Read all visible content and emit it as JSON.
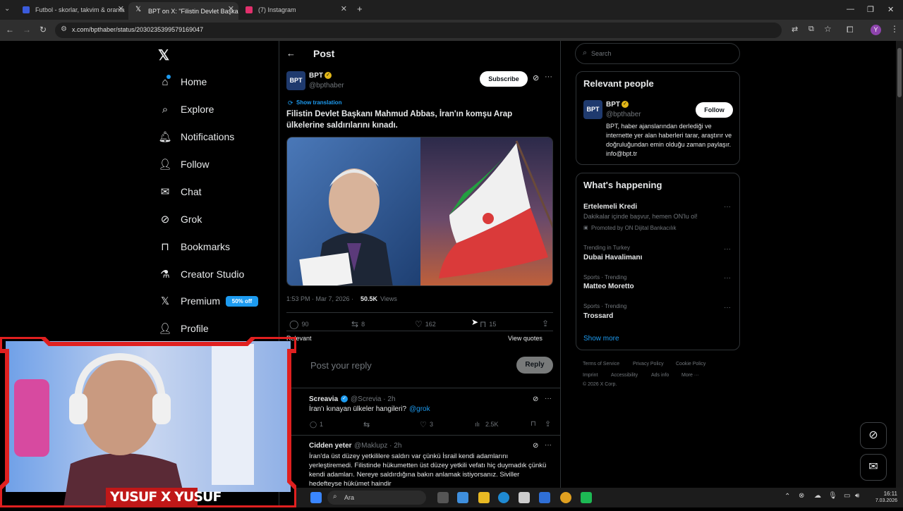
{
  "browser": {
    "tabs": [
      {
        "title": "Futbol - skorlar, takvim & oranla",
        "favicon_color": "#3b5bdb"
      },
      {
        "title": "BPT on X: \"Filistin Devlet Başka",
        "favicon_color": "#ffffff"
      },
      {
        "title": "(7) Instagram",
        "favicon_color": "#e1306c"
      }
    ],
    "url": "x.com/bpthaber/status/2030235399579169047"
  },
  "sidebar": {
    "items": [
      {
        "label": "Home",
        "icon": "home-icon"
      },
      {
        "label": "Explore",
        "icon": "search-icon"
      },
      {
        "label": "Notifications",
        "icon": "bell-icon"
      },
      {
        "label": "Follow",
        "icon": "person-add-icon"
      },
      {
        "label": "Chat",
        "icon": "mail-icon"
      },
      {
        "label": "Grok",
        "icon": "grok-icon"
      },
      {
        "label": "Bookmarks",
        "icon": "bookmark-icon"
      },
      {
        "label": "Creator Studio",
        "icon": "flask-icon"
      },
      {
        "label": "Premium",
        "icon": "x-icon"
      },
      {
        "label": "Profile",
        "icon": "person-icon"
      }
    ],
    "premium_badge": "50% off"
  },
  "post": {
    "header": "Post",
    "author_name": "BPT",
    "author_handle": "@bpthaber",
    "subscribe": "Subscribe",
    "show_translation": "Show translation",
    "text": "Filistin Devlet Başkanı Mahmud Abbas, İran'ın komşu Arap ülkelerine saldırılarını kınadı.",
    "time": "1:53 PM · Mar 7, 2026 ·",
    "views_count": "50.5K",
    "views_label": "Views",
    "replies": "90",
    "reposts": "8",
    "likes": "162",
    "bookmarks": "15",
    "sort": "Relevant",
    "view_quotes": "View quotes",
    "reply_placeholder": "Post your reply",
    "reply_button": "Reply"
  },
  "replies": [
    {
      "name": "Screavia",
      "handle": "@Screvia · 2h",
      "text": "İran'ı kınayan ülkeler hangileri?",
      "mention": "@grok",
      "replies": "1",
      "likes": "3",
      "views": "2.5K"
    },
    {
      "name": "Cidden yeter",
      "handle": "@Maklupz · 2h",
      "text": "İran'da üst düzey yetkililere saldırı var çünkü İsrail kendi adamlarını yerleştiremedi. Filistinde hükumetten üst düzey yetkili vefatı hiç duymadık çünkü kendi adamları. Nereye saldırdığına bakın anlamak istiyorsanız. Siviller hedefteyse hükümet haindir"
    }
  ],
  "right": {
    "search_placeholder": "Search",
    "relevant_title": "Relevant people",
    "person_name": "BPT",
    "person_handle": "@bpthaber",
    "follow": "Follow",
    "person_bio": "BPT, haber ajanslarından derlediği ve internette yer alan haberleri tarar, araştırır ve doğruluğundan emin olduğu zaman paylaşır. info@bpt.tr",
    "happening_title": "What's happening",
    "trends": [
      {
        "title": "Ertelemeli Kredi",
        "sub": "Dakikalar içinde başvur, hemen ON'lu ol!",
        "meta": "Promoted by ON Dijital Bankacılık"
      },
      {
        "meta": "Trending in Turkey",
        "title": "Dubai Havalimanı"
      },
      {
        "meta": "Sports · Trending",
        "title": "Matteo Moretto"
      },
      {
        "meta": "Sports · Trending",
        "title": "Trossard"
      }
    ],
    "show_more": "Show more",
    "footer1": [
      "Terms of Service",
      "Privacy Policy",
      "Cookie Policy"
    ],
    "footer2": [
      "Imprint",
      "Accessibility",
      "Ads info",
      "More ···"
    ],
    "copyright": "© 2026 X Corp."
  },
  "webcam": {
    "overlay_text": "YUSUF X YUSUF"
  },
  "taskbar": {
    "search": "Ara",
    "time": "16:11",
    "date": "7.03.2026"
  }
}
